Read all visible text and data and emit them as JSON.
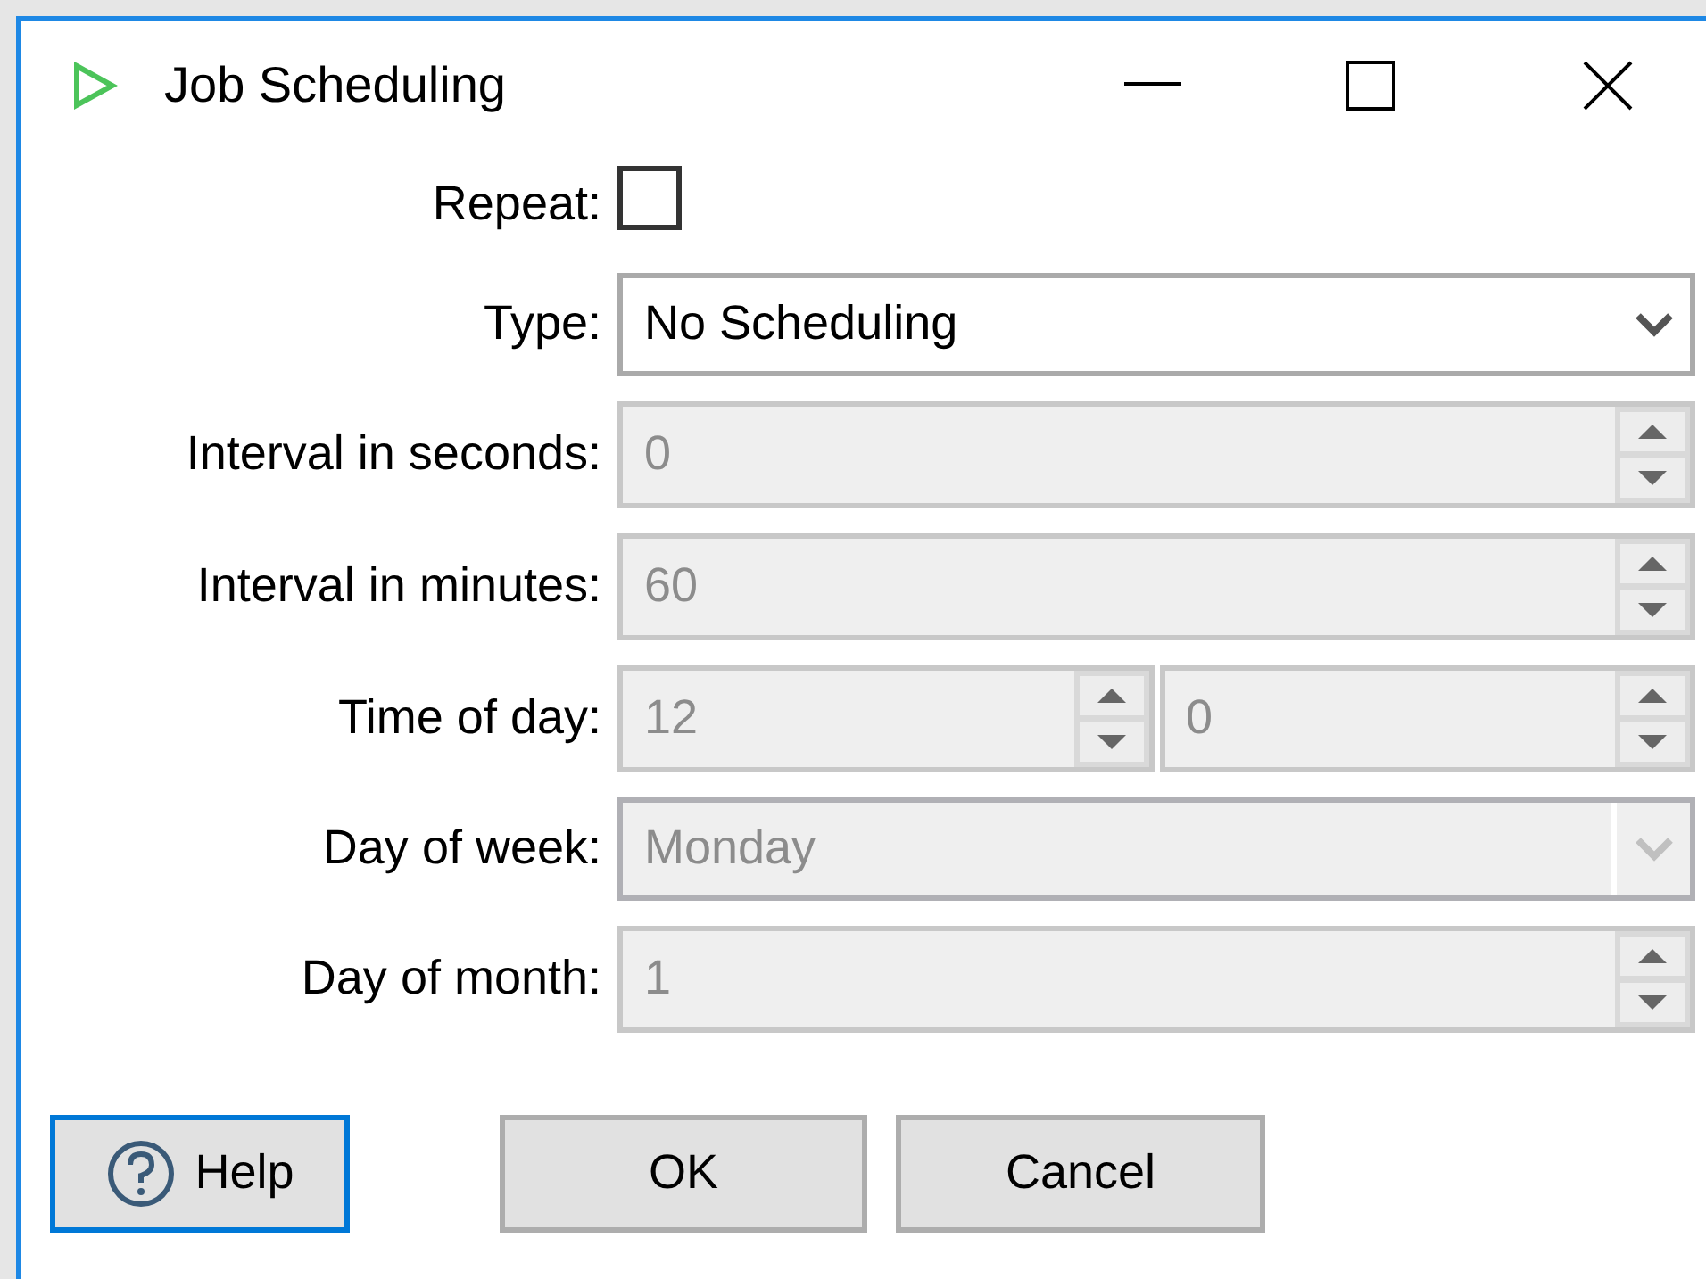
{
  "window": {
    "title": "Job Scheduling"
  },
  "repeat": {
    "label": "Repeat:",
    "checked": false
  },
  "fields": [
    {
      "label": "Type:",
      "kind": "combo",
      "value": "No Scheduling",
      "disabled": false
    },
    {
      "label": "Interval in seconds:",
      "kind": "spinner",
      "value": "0",
      "disabled": true
    },
    {
      "label": "Interval in minutes:",
      "kind": "spinner",
      "value": "60",
      "disabled": true
    },
    {
      "label": "Time of day:",
      "kind": "split",
      "values": [
        "12",
        "0"
      ],
      "disabled": true
    },
    {
      "label": "Day of week:",
      "kind": "combo",
      "value": "Monday",
      "disabled": true
    },
    {
      "label": "Day of month:",
      "kind": "spinner",
      "value": "1",
      "disabled": true
    }
  ],
  "buttons": [
    {
      "label": "Help",
      "kind": "help",
      "focused": true
    },
    {
      "label": "OK",
      "kind": "plain",
      "focused": false
    },
    {
      "label": "Cancel",
      "kind": "plain",
      "focused": false
    }
  ]
}
